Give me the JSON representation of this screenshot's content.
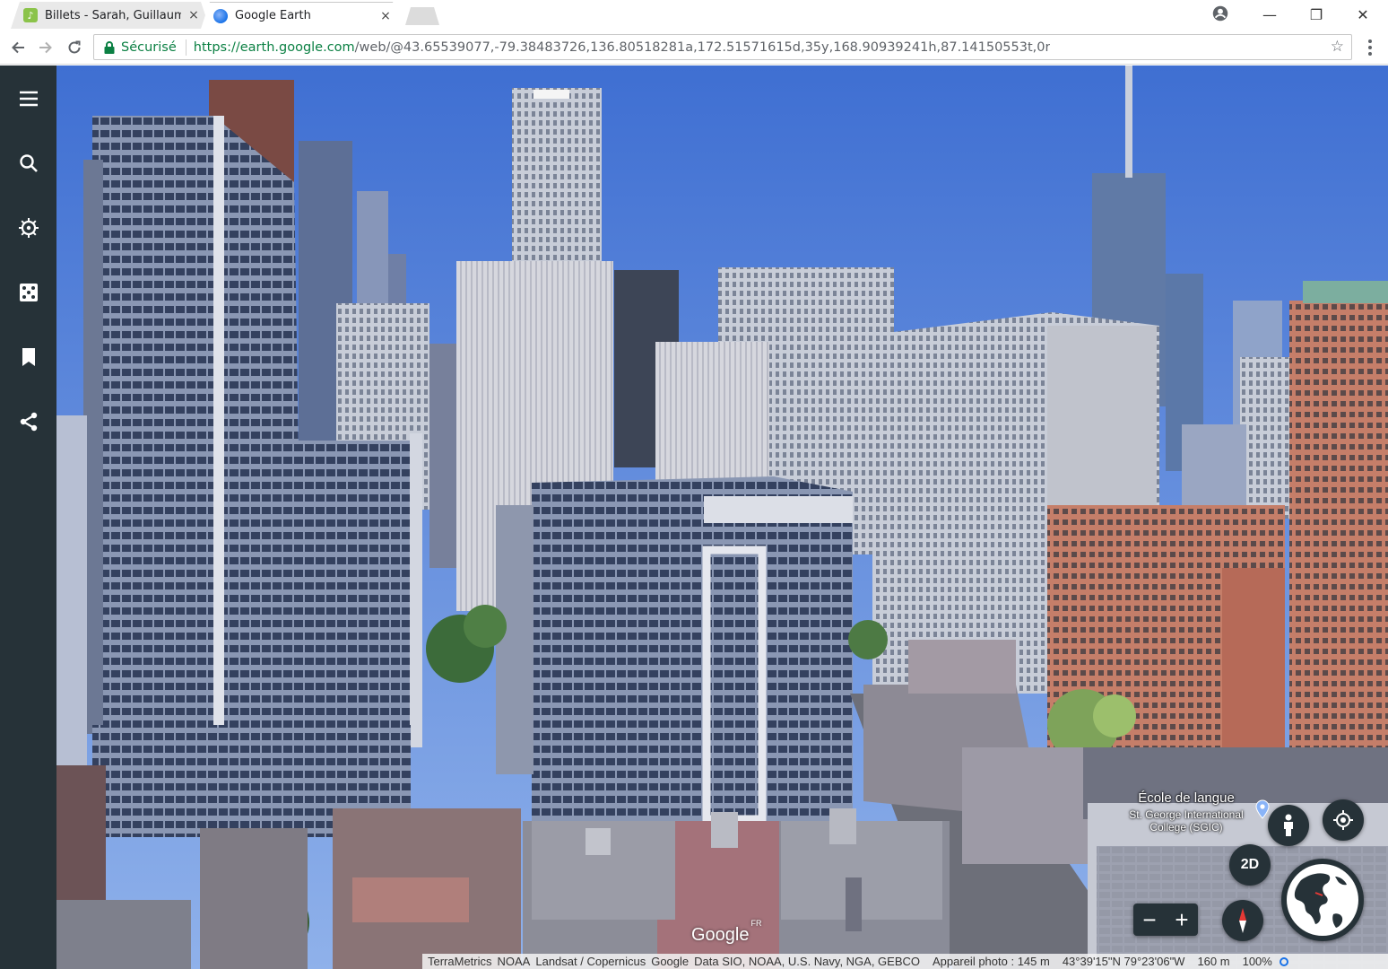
{
  "browser": {
    "tabs": [
      {
        "title": "Billets - Sarah, Guillaume",
        "active": false
      },
      {
        "title": "Google Earth",
        "active": true
      }
    ],
    "tab_close_glyph": "×",
    "window_controls": {
      "minimize": "—",
      "restore": "❐",
      "close": "✕"
    },
    "secure_label": "Sécurisé",
    "url_host": "https://earth.google.com",
    "url_path": "/web/@43.65539077,-79.38483726,136.80518281a,172.51571615d,35y,168.90939241h,87.14150553t,0r",
    "icons": [
      "back-arrow-icon",
      "forward-arrow-icon",
      "reload-icon",
      "lock-icon",
      "star-icon",
      "kebab-menu-icon",
      "profile-icon"
    ]
  },
  "earth": {
    "rail_icons": [
      "menu-icon",
      "search-icon",
      "voyager-icon",
      "feeling-lucky-icon",
      "projects-icon",
      "share-icon"
    ],
    "poi": {
      "main": "École de langue",
      "sub_line1": "St. George International",
      "sub_line2": "College (SGIC)"
    },
    "controls": {
      "view_2d": "2D",
      "zoom_out": "−",
      "zoom_in": "+"
    },
    "watermark": "Google",
    "watermark_region": "FR",
    "attribution": {
      "sources": [
        "TerraMetrics",
        "NOAA",
        "Landsat / Copernicus",
        "Google",
        "Data SIO, NOAA, U.S. Navy, NGA, GEBCO"
      ],
      "camera": "Appareil photo : 145 m",
      "coords": "43°39'15\"N 79°23'06\"W",
      "scale": "160 m",
      "zoom_pct": "100%"
    },
    "colors": {
      "rail": "#263238",
      "secure_green": "#0b8043",
      "sky_top": "#3f6fd2",
      "sky_bottom": "#8fb1ea"
    }
  }
}
